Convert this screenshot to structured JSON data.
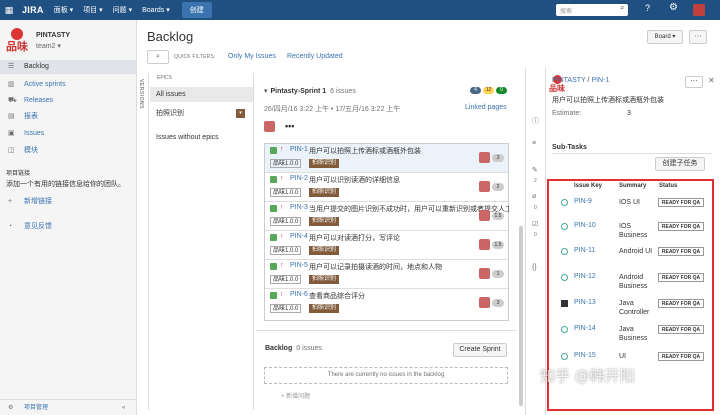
{
  "topbar": {
    "logo": "JIRA",
    "nav": [
      "面板 ▾",
      "项目 ▾",
      "问题 ▾",
      "Boards ▾"
    ],
    "create": "创建",
    "search_placeholder": "搜索",
    "icons": [
      "grid-icon",
      "search-icon",
      "help-icon",
      "gear-icon",
      "avatar"
    ]
  },
  "sidebar": {
    "project_name": "PINTASTY",
    "team": "team2 ▾",
    "items": [
      {
        "label": "Backlog",
        "icon": "backlog-icon",
        "active": true
      },
      {
        "label": "Active sprints",
        "icon": "sprints-icon"
      },
      {
        "label": "Releases",
        "icon": "releases-icon"
      },
      {
        "label": "报表",
        "icon": "reports-icon"
      },
      {
        "label": "Issues",
        "icon": "issues-icon"
      },
      {
        "label": "模块",
        "icon": "components-icon"
      }
    ],
    "links_heading": "项目链接",
    "links_text": "添加一个有用的链接信息给你的团队。",
    "add_link": "新增链接",
    "feedback": "意见反馈",
    "bottom": "项目管理"
  },
  "main": {
    "title": "Backlog",
    "board_btn": "Board ▾",
    "more_btn": "···",
    "quick_filters_label": "QUICK FILTERS:",
    "quick_filters": [
      "Only My Issues",
      "Recently Updated"
    ],
    "versions_label": "VERSIONS"
  },
  "epics": {
    "heading": "EPICS",
    "all": "All issues",
    "epic": "拍照识别",
    "no_epics": "Issues without epics"
  },
  "sprint": {
    "name": "Pintasty-Sprint 1",
    "count": "6 issues",
    "badges": [
      {
        "value": "4",
        "color": "#4a6785"
      },
      {
        "value": "12",
        "color": "#ffd351"
      },
      {
        "value": "0",
        "color": "#14892c"
      }
    ],
    "dates": "26/四月/16 3:22 上午 • 17/五月/16 3:22 上午",
    "linked": "Linked pages",
    "more": "•••",
    "issues": [
      {
        "key": "PIN-1",
        "summary": "用户可以拍照上传酒标或酒瓶外包装",
        "version": "品味1.0.0",
        "epic": "拍照识别",
        "estimate": "3",
        "selected": true
      },
      {
        "key": "PIN-2",
        "summary": "用户可以识别读酒的详细信息",
        "version": "品味1.0.0",
        "epic": "拍照识别",
        "estimate": "2"
      },
      {
        "key": "PIN-3",
        "summary": "当用户提交的图片识别不成功时，用户可以重新识别或者提交人工",
        "version": "品味1.0.0",
        "epic": "拍照识别",
        "estimate": "1.5"
      },
      {
        "key": "PIN-4",
        "summary": "用户可以对读酒打分，写评论",
        "version": "品味1.0.0",
        "epic": "拍照识别",
        "estimate": "1.5"
      },
      {
        "key": "PIN-5",
        "summary": "用户可以记录拍摄读酒的时间，地点和人物",
        "version": "品味1.0.0",
        "epic": "拍照识别",
        "estimate": "1"
      },
      {
        "key": "PIN-6",
        "summary": "查看商品综合评分",
        "version": "品味1.0.0",
        "epic": "拍照识别",
        "estimate": "3"
      }
    ]
  },
  "backlog": {
    "title": "Backlog",
    "count": "0 issues",
    "create_sprint": "Create Sprint",
    "empty": "There are currently no issues in the backlog",
    "add": "+ 新增问题"
  },
  "detail": {
    "project": "PINTASTY",
    "separator": " / ",
    "key": "PIN-1",
    "more": "···",
    "close": "✕",
    "title": "用户可以拍照上传酒标或酒瓶外包装",
    "estimate_label": "Estimate:",
    "estimate_value": "3",
    "subtasks_heading": "Sub-Tasks",
    "create_subtask": "创建子任务",
    "rail_counts": [
      "2",
      "0",
      "0"
    ],
    "columns": [
      "Issue Key",
      "Summary",
      "Status"
    ],
    "subtasks": [
      {
        "key": "PIN-9",
        "summary": "IOS UI",
        "status": "READY FOR QA"
      },
      {
        "key": "PIN-10",
        "summary": "IOS Business",
        "status": "READY FOR QA"
      },
      {
        "key": "PIN-11",
        "summary": "Android UI",
        "status": "READY FOR QA"
      },
      {
        "key": "PIN-12",
        "summary": "Android Business",
        "status": "READY FOR QA"
      },
      {
        "key": "PIN-13",
        "summary": "Java Controller",
        "status": "READY FOR QA"
      },
      {
        "key": "PIN-14",
        "summary": "Java Business",
        "status": "READY FOR QA"
      },
      {
        "key": "PIN-15",
        "summary": "UI",
        "status": "READY FOR QA"
      }
    ]
  },
  "watermark": "知乎 @韩开阳"
}
